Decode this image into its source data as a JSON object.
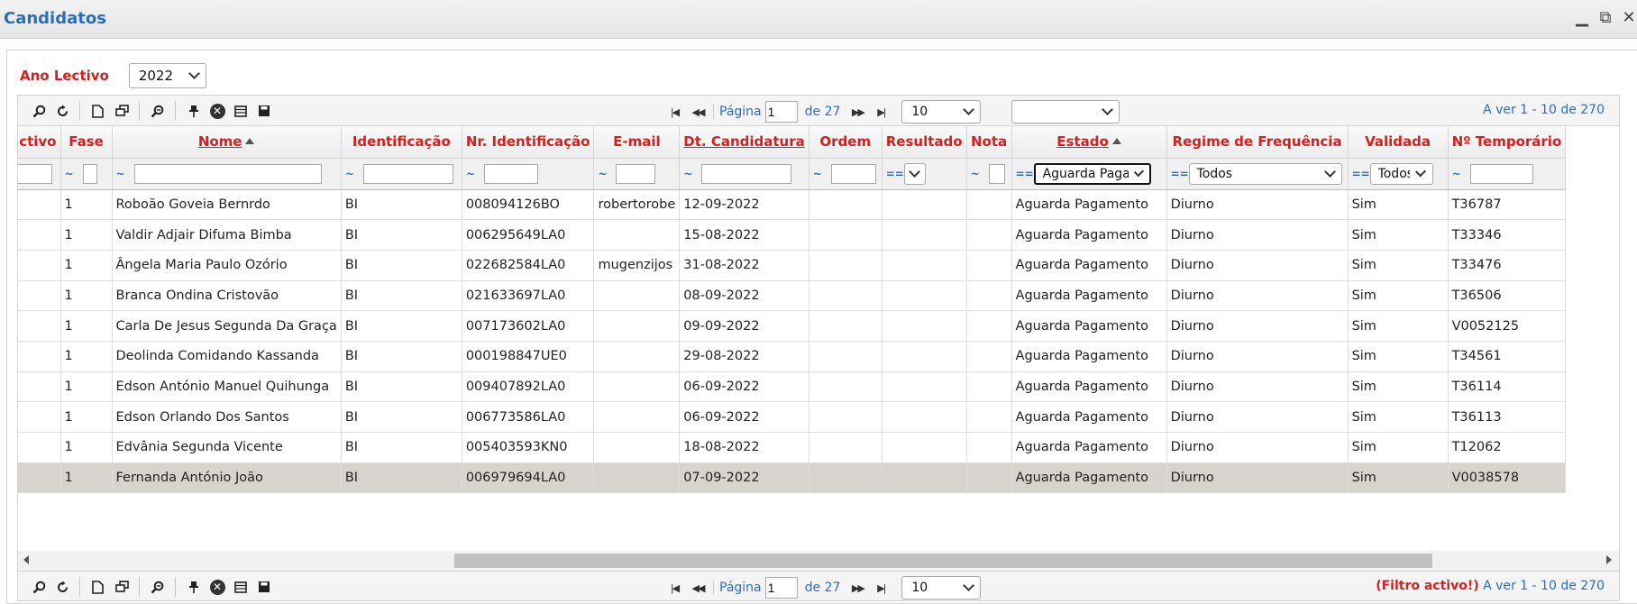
{
  "window": {
    "title": "Candidatos",
    "minimize_glyph": "▁",
    "restore_glyph": "⧉",
    "close_glyph": "✕"
  },
  "filters": {
    "ano_lectivo_label": "Ano Lectivo",
    "ano_lectivo_value": "2022"
  },
  "pager": {
    "page_label": "Página",
    "page_value": "1",
    "of_pages": "de 27",
    "rows_per_page": "10",
    "extra_select": "",
    "viewing_text": "A ver 1 - 10 de 270",
    "filter_active_text": "(Filtro activo!)"
  },
  "columns": [
    {
      "key": "ano",
      "label": "ctivo"
    },
    {
      "key": "fase",
      "label": "Fase"
    },
    {
      "key": "nome",
      "label": "Nome"
    },
    {
      "key": "identificacao",
      "label": "Identificação"
    },
    {
      "key": "nr_ident",
      "label": "Nr. Identificação"
    },
    {
      "key": "email",
      "label": "E-mail"
    },
    {
      "key": "dt_cand",
      "label": "Dt. Candidatura"
    },
    {
      "key": "ordem",
      "label": "Ordem"
    },
    {
      "key": "resultado",
      "label": "Resultado"
    },
    {
      "key": "nota",
      "label": "Nota"
    },
    {
      "key": "estado",
      "label": "Estado"
    },
    {
      "key": "regime",
      "label": "Regime de Frequência"
    },
    {
      "key": "validada",
      "label": "Validada"
    },
    {
      "key": "n_temp",
      "label": "Nº Temporário"
    }
  ],
  "filter_row": {
    "op_approx": "~",
    "op_equal": "==",
    "estado_value": "Aguarda Pagamento",
    "regime_value": "Todos",
    "validada_value": "Todos"
  },
  "rows": [
    {
      "ano": "",
      "fase": "1",
      "nome": "Roboão Goveia Bernrdo",
      "identificacao": "BI",
      "nr_ident": "008094126BO",
      "email": "robertorobe",
      "dt_cand": "12-09-2022",
      "ordem": "",
      "resultado": "",
      "nota": "",
      "estado": "Aguarda Pagamento",
      "regime": "Diurno",
      "validada": "Sim",
      "n_temp": "T36787"
    },
    {
      "ano": "",
      "fase": "1",
      "nome": "Valdir Adjair Difuma Bimba",
      "identificacao": "BI",
      "nr_ident": "006295649LA0",
      "email": "",
      "dt_cand": "15-08-2022",
      "ordem": "",
      "resultado": "",
      "nota": "",
      "estado": "Aguarda Pagamento",
      "regime": "Diurno",
      "validada": "Sim",
      "n_temp": "T33346"
    },
    {
      "ano": "",
      "fase": "1",
      "nome": "Ângela Maria Paulo Ozório",
      "identificacao": "BI",
      "nr_ident": "022682584LA0",
      "email": "mugenzijos",
      "dt_cand": "31-08-2022",
      "ordem": "",
      "resultado": "",
      "nota": "",
      "estado": "Aguarda Pagamento",
      "regime": "Diurno",
      "validada": "Sim",
      "n_temp": "T33476"
    },
    {
      "ano": "",
      "fase": "1",
      "nome": "Branca Ondina Cristovão",
      "identificacao": "BI",
      "nr_ident": "021633697LA0",
      "email": "",
      "dt_cand": "08-09-2022",
      "ordem": "",
      "resultado": "",
      "nota": "",
      "estado": "Aguarda Pagamento",
      "regime": "Diurno",
      "validada": "Sim",
      "n_temp": "T36506"
    },
    {
      "ano": "",
      "fase": "1",
      "nome": "Carla De Jesus Segunda Da Graça",
      "identificacao": "BI",
      "nr_ident": "007173602LA0",
      "email": "",
      "dt_cand": "09-09-2022",
      "ordem": "",
      "resultado": "",
      "nota": "",
      "estado": "Aguarda Pagamento",
      "regime": "Diurno",
      "validada": "Sim",
      "n_temp": "V0052125"
    },
    {
      "ano": "",
      "fase": "1",
      "nome": "Deolinda Comidando Kassanda",
      "identificacao": "BI",
      "nr_ident": "000198847UE0",
      "email": "",
      "dt_cand": "29-08-2022",
      "ordem": "",
      "resultado": "",
      "nota": "",
      "estado": "Aguarda Pagamento",
      "regime": "Diurno",
      "validada": "Sim",
      "n_temp": "T34561"
    },
    {
      "ano": "",
      "fase": "1",
      "nome": "Edson António Manuel Quihunga",
      "identificacao": "BI",
      "nr_ident": "009407892LA0",
      "email": "",
      "dt_cand": "06-09-2022",
      "ordem": "",
      "resultado": "",
      "nota": "",
      "estado": "Aguarda Pagamento",
      "regime": "Diurno",
      "validada": "Sim",
      "n_temp": "T36114"
    },
    {
      "ano": "",
      "fase": "1",
      "nome": "Edson Orlando Dos Santos",
      "identificacao": "BI",
      "nr_ident": "006773586LA0",
      "email": "",
      "dt_cand": "06-09-2022",
      "ordem": "",
      "resultado": "",
      "nota": "",
      "estado": "Aguarda Pagamento",
      "regime": "Diurno",
      "validada": "Sim",
      "n_temp": "T36113"
    },
    {
      "ano": "",
      "fase": "1",
      "nome": "Edvânia Segunda Vicente",
      "identificacao": "BI",
      "nr_ident": "005403593KN0",
      "email": "",
      "dt_cand": "18-08-2022",
      "ordem": "",
      "resultado": "",
      "nota": "",
      "estado": "Aguarda Pagamento",
      "regime": "Diurno",
      "validada": "Sim",
      "n_temp": "T12062"
    },
    {
      "ano": "",
      "fase": "1",
      "nome": "Fernanda António João",
      "identificacao": "BI",
      "nr_ident": "006979694LA0",
      "email": "",
      "dt_cand": "07-09-2022",
      "ordem": "",
      "resultado": "",
      "nota": "",
      "estado": "Aguarda Pagamento",
      "regime": "Diurno",
      "validada": "Sim",
      "n_temp": "V0038578"
    }
  ],
  "selected_row_index": 9,
  "colors": {
    "title_blue": "#2a6ebb",
    "header_red": "#d42020",
    "selected_row": "#d7d3cd"
  }
}
